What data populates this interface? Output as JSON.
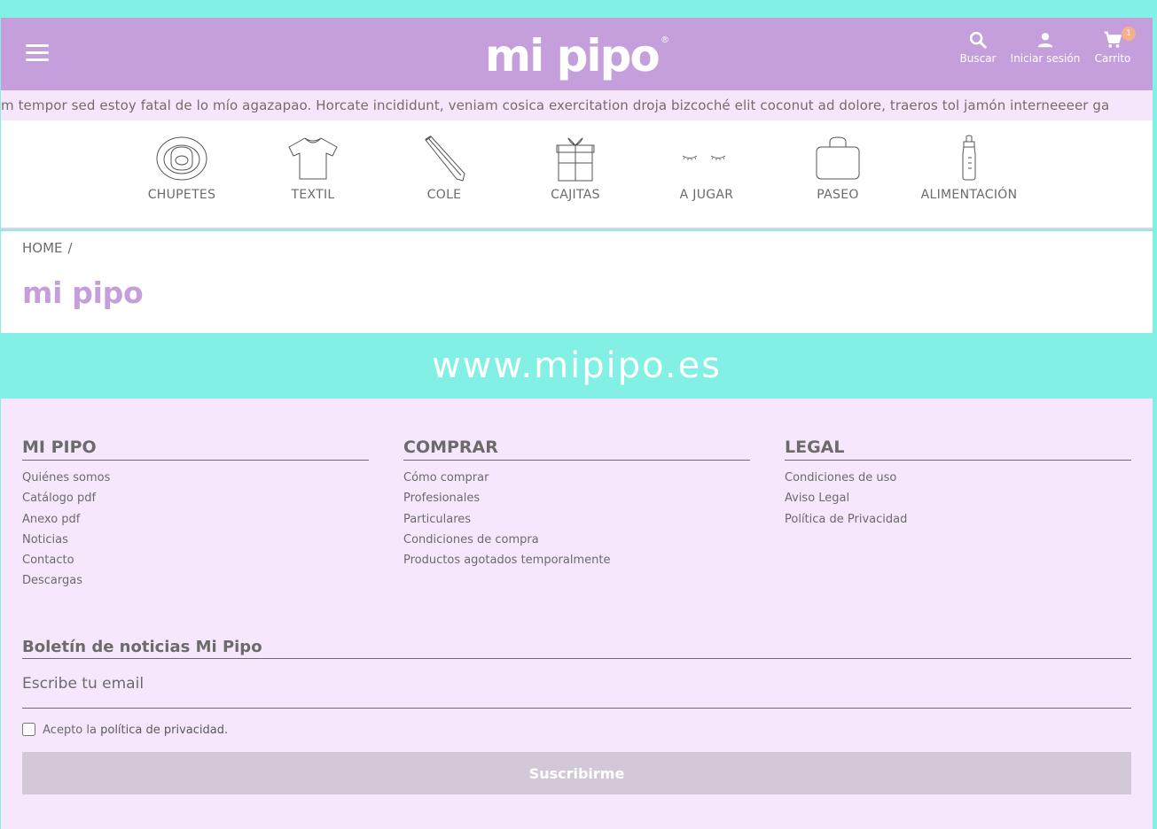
{
  "header": {
    "logo_text": "mi pipo",
    "actions": [
      {
        "label": "Buscar",
        "icon": "search-icon"
      },
      {
        "label": "Iniciar sesión",
        "icon": "user-icon"
      },
      {
        "label": "Carrito",
        "icon": "cart-icon",
        "badge": "1"
      }
    ]
  },
  "ticker": {
    "text": "m tempor sed estoy fatal de lo mío agazapao. Horcate incididunt, veniam cosica exercitation droja bizcoché elit coconut ad dolore, traeros tol jamón interneeeer ga"
  },
  "categories": [
    {
      "label": "CHUPETES",
      "icon": "pacifier-icon"
    },
    {
      "label": "TEXTIL",
      "icon": "tshirt-icon"
    },
    {
      "label": "COLE",
      "icon": "pencil-icon"
    },
    {
      "label": "CAJITAS",
      "icon": "gift-box-icon"
    },
    {
      "label": "A JUGAR",
      "icon": "closed-eyes-icon"
    },
    {
      "label": "PASEO",
      "icon": "bag-icon"
    },
    {
      "label": "ALIMENTACIÓN",
      "icon": "baby-bottle-icon"
    }
  ],
  "breadcrumb": {
    "home": "HOME",
    "separator": "/"
  },
  "page_title": "mi pipo",
  "domain_banner": "www.mipipo.es",
  "footer": {
    "columns": [
      {
        "title": "MI PIPO",
        "links": [
          "Quiénes somos",
          "Catálogo pdf",
          "Anexo pdf",
          "Noticias",
          "Contacto",
          "Descargas"
        ]
      },
      {
        "title": "COMPRAR",
        "links": [
          "Cómo comprar",
          "Profesionales",
          "Particulares",
          "Condiciones de compra",
          "Productos agotados temporalmente"
        ]
      },
      {
        "title": "LEGAL",
        "links": [
          "Condiciones de uso",
          "Aviso Legal",
          "Política de Privacidad"
        ]
      }
    ],
    "newsletter": {
      "title": "Boletín de noticias Mi Pipo",
      "email_placeholder": "Escribe tu email",
      "consent_prefix": "Acepto la",
      "consent_link": "política de privacidad.",
      "button_label": "Suscribirme"
    }
  },
  "colors": {
    "header_bg": "#c59fdb",
    "turquoise": "#82f0e4",
    "footer_bg": "#f7e7fd",
    "badge": "#f6b08d",
    "button_disabled": "#d3c8d8"
  }
}
